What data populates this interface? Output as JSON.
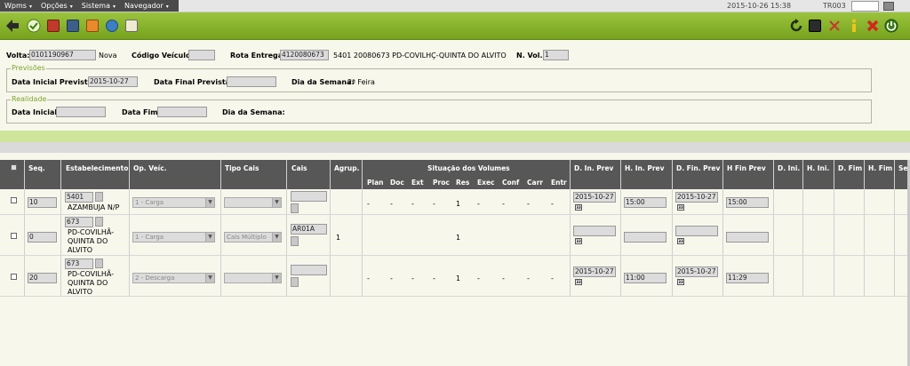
{
  "menu": [
    {
      "label": "Wpms"
    },
    {
      "label": "Opções"
    },
    {
      "label": "Sistema"
    },
    {
      "label": "Navegador"
    }
  ],
  "header": {
    "datetime": "2015-10-26 15:38",
    "terminal": "TR003"
  },
  "form": {
    "volta_label": "Volta:",
    "volta_value": "0101190967",
    "volta_status": "Nova",
    "codigo_label": "Código Veículo:",
    "codigo_value": "",
    "rota_label": "Rota Entrega:",
    "rota_value": "4120080673",
    "rota_desc": "5401 20080673 PD-COVILHÇ-QUINTA DO ALVITO",
    "nvol_label": "N. Vol.:",
    "nvol_value": "1",
    "previsoes": {
      "legend": "Previsões",
      "data_inicial_label": "Data Inicial Prevista:",
      "data_inicial_value": "2015-10-27",
      "data_final_label": "Data Final Prevista:",
      "data_final_value": "",
      "dia_label": "Dia da Semana:",
      "dia_value": "2ª Feira"
    },
    "realidade": {
      "legend": "Realidade",
      "data_inicial_label": "Data Inicial:",
      "data_inicial_value": "",
      "data_fim_label": "Data Fim:",
      "data_fim_value": "",
      "dia_label": "Dia da Semana:",
      "dia_value": ""
    }
  },
  "grid": {
    "headers": {
      "seq": "Seq.",
      "estab": "Estabelecimento",
      "opveic": "Op. Veíc.",
      "tipocais": "Tipo Cais",
      "cais": "Cais",
      "agrup": "Agrup.",
      "situacao": "Situação dos Volumes",
      "dinprev": "D. In. Prev",
      "hinprev": "H. In. Prev",
      "dfinprev": "D. Fin. Prev",
      "hfinprev": "H Fin Prev",
      "dini": "D. Ini.",
      "hini": "H. Ini.",
      "dfim": "D. Fim",
      "hfim": "H. Fim",
      "se": "Se"
    },
    "sub_headers": [
      "Plan",
      "Doc",
      "Ext",
      "Proc",
      "Res",
      "Exec",
      "Conf",
      "Carr",
      "Entr"
    ],
    "rows": [
      {
        "seq": "10",
        "estab_code": "5401",
        "estab_name": "AZAMBUJA N/P",
        "opveic": "1 - Carga",
        "tipocais": "",
        "cais": "",
        "agrup": "",
        "sit": [
          "-",
          "-",
          "-",
          "-",
          "1",
          "-",
          "-",
          "-",
          "-"
        ],
        "din": "2015-10-27",
        "hin": "15:00",
        "dfin": "2015-10-27",
        "hfin": "15:00"
      },
      {
        "seq": "0",
        "estab_code": "673",
        "estab_name": "PD-COVILHÃ-\nQUINTA DO\nALVITO",
        "opveic": "1 - Carga",
        "tipocais": "Cais Múltiplo",
        "cais": "AR01A",
        "agrup": "1",
        "sit": [
          "",
          "",
          "",
          "",
          "1",
          "",
          "",
          "",
          ""
        ],
        "din": "",
        "hin": "",
        "dfin": "",
        "hfin": ""
      },
      {
        "seq": "20",
        "estab_code": "673",
        "estab_name": "PD-COVILHÃ-\nQUINTA DO\nALVITO",
        "opveic": "2 - Descarga",
        "tipocais": "",
        "cais": "",
        "agrup": "",
        "sit": [
          "-",
          "-",
          "-",
          "-",
          "1",
          "-",
          "-",
          "-",
          "-"
        ],
        "din": "2015-10-27",
        "hin": "11:00",
        "dfin": "2015-10-27",
        "hfin": "11:29"
      }
    ]
  },
  "icons": {
    "back": "arrow-left-icon",
    "confirm": "check-circle-icon",
    "truck": "truck-icon",
    "tools": "tools-icon",
    "puzzle": "puzzle-icon",
    "globe": "globe-icon",
    "edit": "edit-note-icon",
    "refresh": "refresh-icon",
    "screen": "monitor-icon",
    "collapse": "collapse-icon",
    "info": "info-icon",
    "close": "close-icon",
    "exit": "exit-icon",
    "calendar": "calendar-icon"
  },
  "colors": {
    "toolbar": "#86b22a",
    "header_row": "#575757",
    "legend": "#7fa52c",
    "band": "#cfe59b"
  }
}
